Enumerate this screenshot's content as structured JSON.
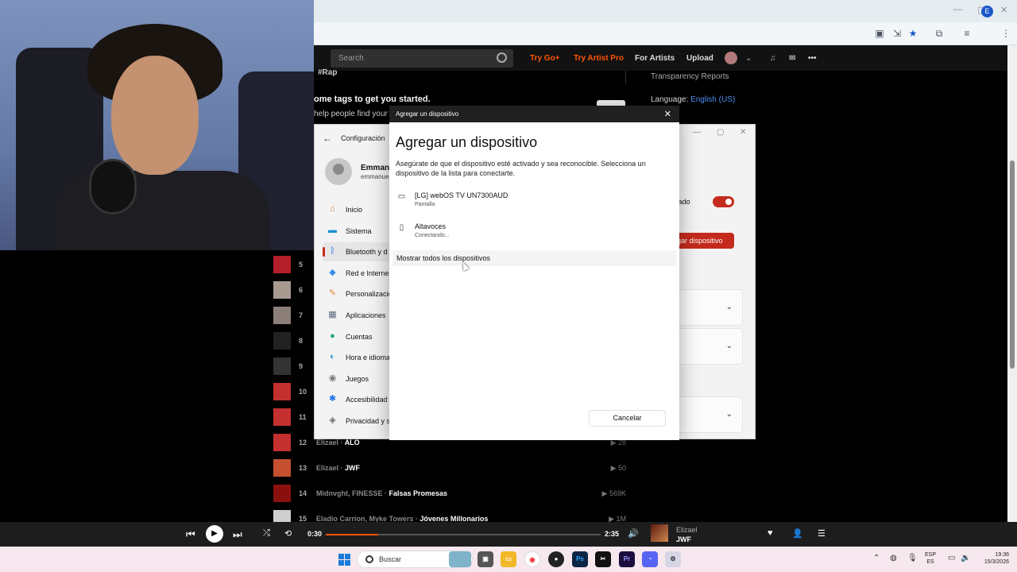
{
  "browser": {
    "win_controls": [
      "—",
      "▢",
      "✕"
    ]
  },
  "soundcloud": {
    "search_placeholder": "Search",
    "try_go": "Try Go+",
    "try_artist": "Try Artist Pro",
    "for_artists": "For Artists",
    "upload": "Upload",
    "tag": "#Rap",
    "tags_heading": "ome tags to get you started.",
    "tags_sub": "help people find your pl",
    "transparency": "Transparency Reports",
    "language_label": "Language:",
    "language_value": "English (US)",
    "accent_color": "#ff5500"
  },
  "tracks": [
    {
      "num": "5",
      "artist": "",
      "title": "",
      "plays": ""
    },
    {
      "num": "6",
      "artist": "",
      "title": "",
      "plays": ""
    },
    {
      "num": "7",
      "artist": "",
      "title": "",
      "plays": ""
    },
    {
      "num": "8",
      "artist": "",
      "title": "",
      "plays": ""
    },
    {
      "num": "9",
      "artist": "",
      "title": "",
      "plays": ""
    },
    {
      "num": "10",
      "artist": "",
      "title": "",
      "plays": ""
    },
    {
      "num": "11",
      "artist": "",
      "title": "",
      "plays": ""
    },
    {
      "num": "12",
      "artist": "Elizael",
      "title": "ALO",
      "plays": "28"
    },
    {
      "num": "13",
      "artist": "Elizael",
      "title": "JWF",
      "plays": "50"
    },
    {
      "num": "14",
      "artist": "Midnvght, FINESSE",
      "title": "Falsas Promesas",
      "plays": "569K"
    },
    {
      "num": "15",
      "artist": "Eladio Carrion, Myke Towers",
      "title": "Jóvenes Millonarios",
      "plays": "1M"
    }
  ],
  "player": {
    "current_time": "0:30",
    "total_time": "2:35",
    "progress": 0.19,
    "now_artist": "Elizael",
    "now_title": "JWF"
  },
  "settings": {
    "app_title": "Configuración",
    "user_name": "Emmanu",
    "user_mail": "emmanue",
    "nav": [
      {
        "label": "Inicio",
        "icon": "home-icon",
        "glyph": "⌂",
        "color": "#e07b39"
      },
      {
        "label": "Sistema",
        "icon": "system-icon",
        "glyph": "▬",
        "color": "#1a8fd6"
      },
      {
        "label": "Bluetooth y d",
        "icon": "bluetooth-icon",
        "glyph": "ᛒ",
        "color": "#1a73e8"
      },
      {
        "label": "Red e Interne",
        "icon": "network-icon",
        "glyph": "◆",
        "color": "#3b8ee8"
      },
      {
        "label": "Personalizació",
        "icon": "brush-icon",
        "glyph": "✎",
        "color": "#d98b30"
      },
      {
        "label": "Aplicaciones",
        "icon": "apps-icon",
        "glyph": "▦",
        "color": "#5a6b80"
      },
      {
        "label": "Cuentas",
        "icon": "accounts-icon",
        "glyph": "●",
        "color": "#1fa57a"
      },
      {
        "label": "Hora e idioma",
        "icon": "clock-globe-icon",
        "glyph": "◐",
        "color": "#2a8ed6"
      },
      {
        "label": "Juegos",
        "icon": "gamepad-icon",
        "glyph": "◉",
        "color": "#777777"
      },
      {
        "label": "Accesibilidad",
        "icon": "accessibility-icon",
        "glyph": "✱",
        "color": "#1a73e8"
      },
      {
        "label": "Privacidad y s",
        "icon": "shield-icon",
        "glyph": "◈",
        "color": "#6b6b6b"
      }
    ],
    "bt_status_partial": "vado",
    "add_device_partial": "gar dispositivo"
  },
  "dialog": {
    "window_title": "Agregar un dispositivo",
    "heading": "Agregar un dispositivo",
    "description": "Asegúrate de que el dispositivo esté activado y sea reconocible. Selecciona un dispositivo de la lista para conectarte.",
    "devices": [
      {
        "name": "[LG] webOS TV UN7300AUD",
        "status": "Pantalla",
        "icon": "monitor-icon"
      },
      {
        "name": "Altavoces",
        "status": "Conectando...",
        "icon": "speaker-icon"
      }
    ],
    "show_all": "Mostrar todos los dispositivos",
    "cancel": "Cancelar"
  },
  "taskbar": {
    "search": "Buscar",
    "lang_top": "ESP",
    "lang_bottom": "ES",
    "time": "19:36",
    "date": "15/3/2026"
  }
}
